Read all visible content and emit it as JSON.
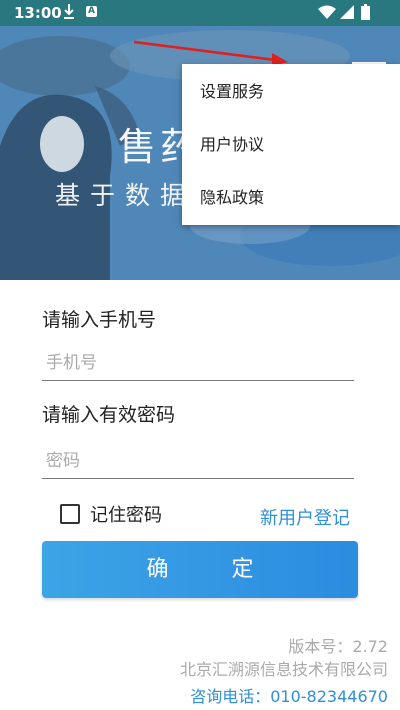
{
  "status_bar": {
    "time": "13:00",
    "download_icon": "download-icon",
    "app_badge": "A",
    "wifi_icon": "wifi-icon",
    "signal_icon": "cell-signal-icon",
    "battery_icon": "battery-icon"
  },
  "banner": {
    "title": "售药",
    "subtitle": "基于数据"
  },
  "menu": {
    "icon": "hamburger-menu-icon",
    "items": [
      "设置服务",
      "用户协议",
      "隐私政策"
    ]
  },
  "form": {
    "phone_label": "请输入手机号",
    "phone_placeholder": "手机号",
    "password_label": "请输入有效密码",
    "password_placeholder": "密码",
    "remember_label": "记住密码",
    "remember_checked": false,
    "register_link": "新用户登记",
    "confirm_button": "确 定"
  },
  "footer": {
    "version": "版本号：2.72",
    "company": "北京汇溯源信息技术有限公司",
    "phone": "咨询电话：010-82344670"
  },
  "colors": {
    "status_bar": "#29777f",
    "accent": "#2f8fd8",
    "button": "#3da4e6",
    "annotation_arrow": "#e02020"
  }
}
